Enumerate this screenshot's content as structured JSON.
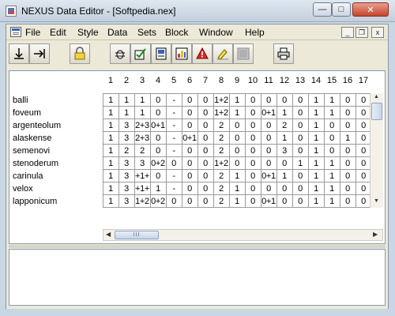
{
  "window": {
    "title": "NEXUS Data Editor - [Softpedia.nex]",
    "minimize_glyph": "—",
    "maximize_glyph": "□",
    "close_glyph": "✕"
  },
  "menu": {
    "items": [
      "File",
      "Edit",
      "Style",
      "Data",
      "Sets",
      "Block",
      "Window",
      "Help"
    ],
    "mdi_minimize": "_",
    "mdi_restore": "❐",
    "mdi_close": "x"
  },
  "toolbar": {
    "icons": [
      "move-down-icon",
      "move-to-end-icon",
      "lock-icon",
      "bug-icon",
      "edit-check-icon",
      "document-icon",
      "chart-icon",
      "warning-icon",
      "highlighter-icon",
      "gray-tile-icon",
      "printer-icon"
    ]
  },
  "matrix": {
    "columns": [
      "1",
      "2",
      "3",
      "4",
      "5",
      "6",
      "7",
      "8",
      "9",
      "10",
      "11",
      "12",
      "13",
      "14",
      "15",
      "16",
      "17"
    ],
    "rows": [
      {
        "taxon": "balli",
        "cells": [
          "1",
          "1",
          "1",
          "0",
          "-",
          "0",
          "0",
          "1+2",
          "1",
          "0",
          "0",
          "0",
          "0",
          "1",
          "1",
          "0",
          "0"
        ]
      },
      {
        "taxon": "foveum",
        "cells": [
          "1",
          "1",
          "1",
          "0",
          "-",
          "0",
          "0",
          "1+2",
          "1",
          "0",
          "0+1",
          "1",
          "0",
          "1",
          "1",
          "0",
          "0"
        ]
      },
      {
        "taxon": "argenteolum",
        "cells": [
          "1",
          "3",
          "2+3",
          "0+1",
          "-",
          "0",
          "0",
          "2",
          "0",
          "0",
          "0",
          "2",
          "0",
          "1",
          "0",
          "0",
          "0"
        ]
      },
      {
        "taxon": "alaskense",
        "cells": [
          "1",
          "3",
          "2+3",
          "0",
          "-",
          "0+1",
          "0",
          "2",
          "0",
          "0",
          "0",
          "1",
          "0",
          "1",
          "0",
          "1",
          "0"
        ]
      },
      {
        "taxon": "semenovi",
        "cells": [
          "1",
          "2",
          "2",
          "0",
          "-",
          "0",
          "0",
          "2",
          "0",
          "0",
          "0",
          "3",
          "0",
          "1",
          "0",
          "0",
          "0"
        ]
      },
      {
        "taxon": "stenoderum",
        "cells": [
          "1",
          "3",
          "3",
          "0+2",
          "0",
          "0",
          "0",
          "1+2",
          "0",
          "0",
          "0",
          "0",
          "1",
          "1",
          "1",
          "0",
          "0"
        ]
      },
      {
        "taxon": "carinula",
        "cells": [
          "1",
          "3",
          "+1+",
          "0",
          "-",
          "0",
          "0",
          "2",
          "1",
          "0",
          "0+1",
          "1",
          "0",
          "1",
          "1",
          "0",
          "0"
        ]
      },
      {
        "taxon": "velox",
        "cells": [
          "1",
          "3",
          "+1+",
          "1",
          "-",
          "0",
          "0",
          "2",
          "1",
          "0",
          "0",
          "0",
          "0",
          "1",
          "1",
          "0",
          "0"
        ]
      },
      {
        "taxon": "lapponicum",
        "cells": [
          "1",
          "3",
          "1+2",
          "0+2",
          "0",
          "0",
          "0",
          "2",
          "1",
          "0",
          "0+1",
          "0",
          "0",
          "1",
          "1",
          "0",
          "0"
        ]
      }
    ]
  },
  "scroll": {
    "thumb_grip": "III",
    "left_arrow": "◀",
    "right_arrow": "▶",
    "up_arrow": "▲",
    "down_arrow": "▼"
  }
}
